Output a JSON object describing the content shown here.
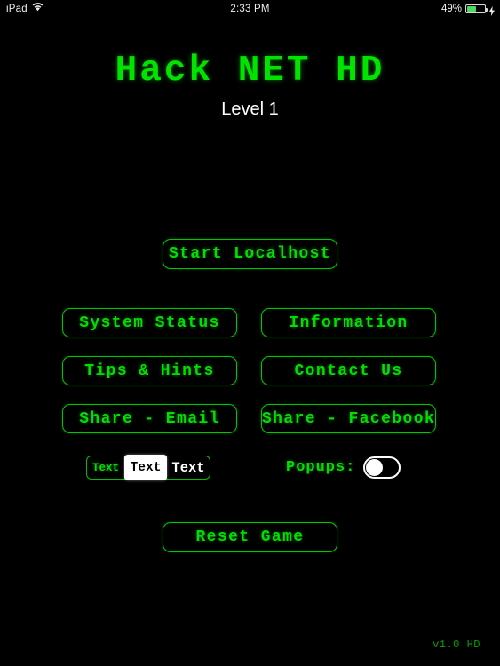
{
  "status_bar": {
    "device_name": "iPad",
    "wifi_icon": "wifi-icon",
    "time": "2:33 PM",
    "battery_percent": "49%",
    "battery_level": 49,
    "battery_icon": "battery-icon",
    "charging_icon": "lightning-bolt-icon"
  },
  "header": {
    "title": "Hack NET HD",
    "level": "Level 1"
  },
  "main": {
    "primary_action": "Start Localhost",
    "menu_buttons": [
      {
        "label": "System Status"
      },
      {
        "label": "Information"
      },
      {
        "label": "Tips & Hints"
      },
      {
        "label": "Contact Us"
      },
      {
        "label": "Share - Email"
      },
      {
        "label": "Share - Facebook"
      }
    ],
    "text_size": {
      "options": [
        {
          "label": "Text",
          "size": "small",
          "selected": false
        },
        {
          "label": "Text",
          "size": "medium",
          "selected": true
        },
        {
          "label": "Text",
          "size": "large",
          "selected": false
        }
      ]
    },
    "popups": {
      "label": "Popups:",
      "state": "off"
    },
    "reset_action": "Reset Game"
  },
  "footer": {
    "version": "v1.0 HD"
  },
  "colors": {
    "background": "#000000",
    "accent_green": "#00e000",
    "border_green": "#00c800",
    "dim_green": "#00a400",
    "white": "#ffffff",
    "battery_green": "#4cd964"
  }
}
